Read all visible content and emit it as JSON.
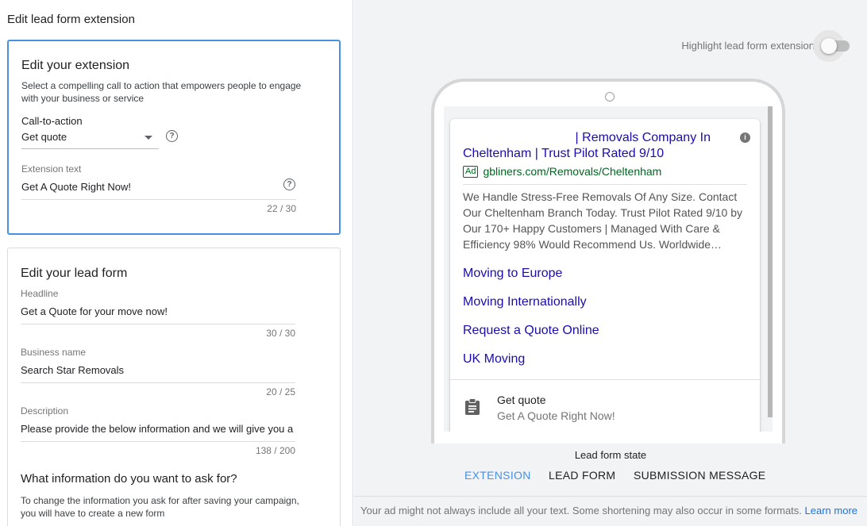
{
  "page_title": "Edit lead form extension",
  "extension": {
    "title": "Edit your extension",
    "hint": "Select a compelling call to action that empowers people to engage with your business or service",
    "cta_label": "Call-to-action",
    "cta_value": "Get quote",
    "text_label": "Extension text",
    "text_value": "Get A Quote Right Now!",
    "text_counter": "22 / 30"
  },
  "lead_form": {
    "title": "Edit your lead form",
    "headline_label": "Headline",
    "headline_value": "Get a Quote for your move now!",
    "headline_counter": "30 / 30",
    "business_label": "Business name",
    "business_value": "Search Star Removals",
    "business_counter": "20 / 25",
    "description_label": "Description",
    "description_value": "Please provide the below information and we will give you a q",
    "description_counter": "138 / 200",
    "ask_title": "What information do you want to ask for?",
    "ask_hint": "To change the information you ask for after saving your campaign, you will have to create a new form"
  },
  "preview": {
    "toggle_label": "Highlight lead form extension",
    "toggle_on": false,
    "ad": {
      "title_line1": "| Removals Company In",
      "title_line2": "Cheltenham | Trust Pilot Rated 9/10",
      "badge": "Ad",
      "url": "gbliners.com/Removals/Cheltenham",
      "description": "We Handle Stress-Free Removals Of Any Size. Contact Our Cheltenham Branch Today. Trust Pilot Rated 9/10 by Our 170+ Happy Customers | Managed With Care & Efficiency 98% Would Recommend Us. Worldwide…",
      "sitelinks": [
        "Moving to Europe",
        "Moving Internationally",
        "Request a Quote Online",
        "UK Moving"
      ],
      "lead_cta": "Get quote",
      "lead_text": "Get A Quote Right Now!"
    },
    "state_label": "Lead form state",
    "tabs": [
      "EXTENSION",
      "LEAD FORM",
      "SUBMISSION MESSAGE"
    ],
    "active_tab": 0,
    "footer_text": "Your ad might not always include all your text. Some shortening may also occur in some formats.",
    "footer_link": "Learn more"
  },
  "colors": {
    "accent": "#4a90e2",
    "ad_link": "#1a0dab",
    "ad_url": "#006621"
  }
}
